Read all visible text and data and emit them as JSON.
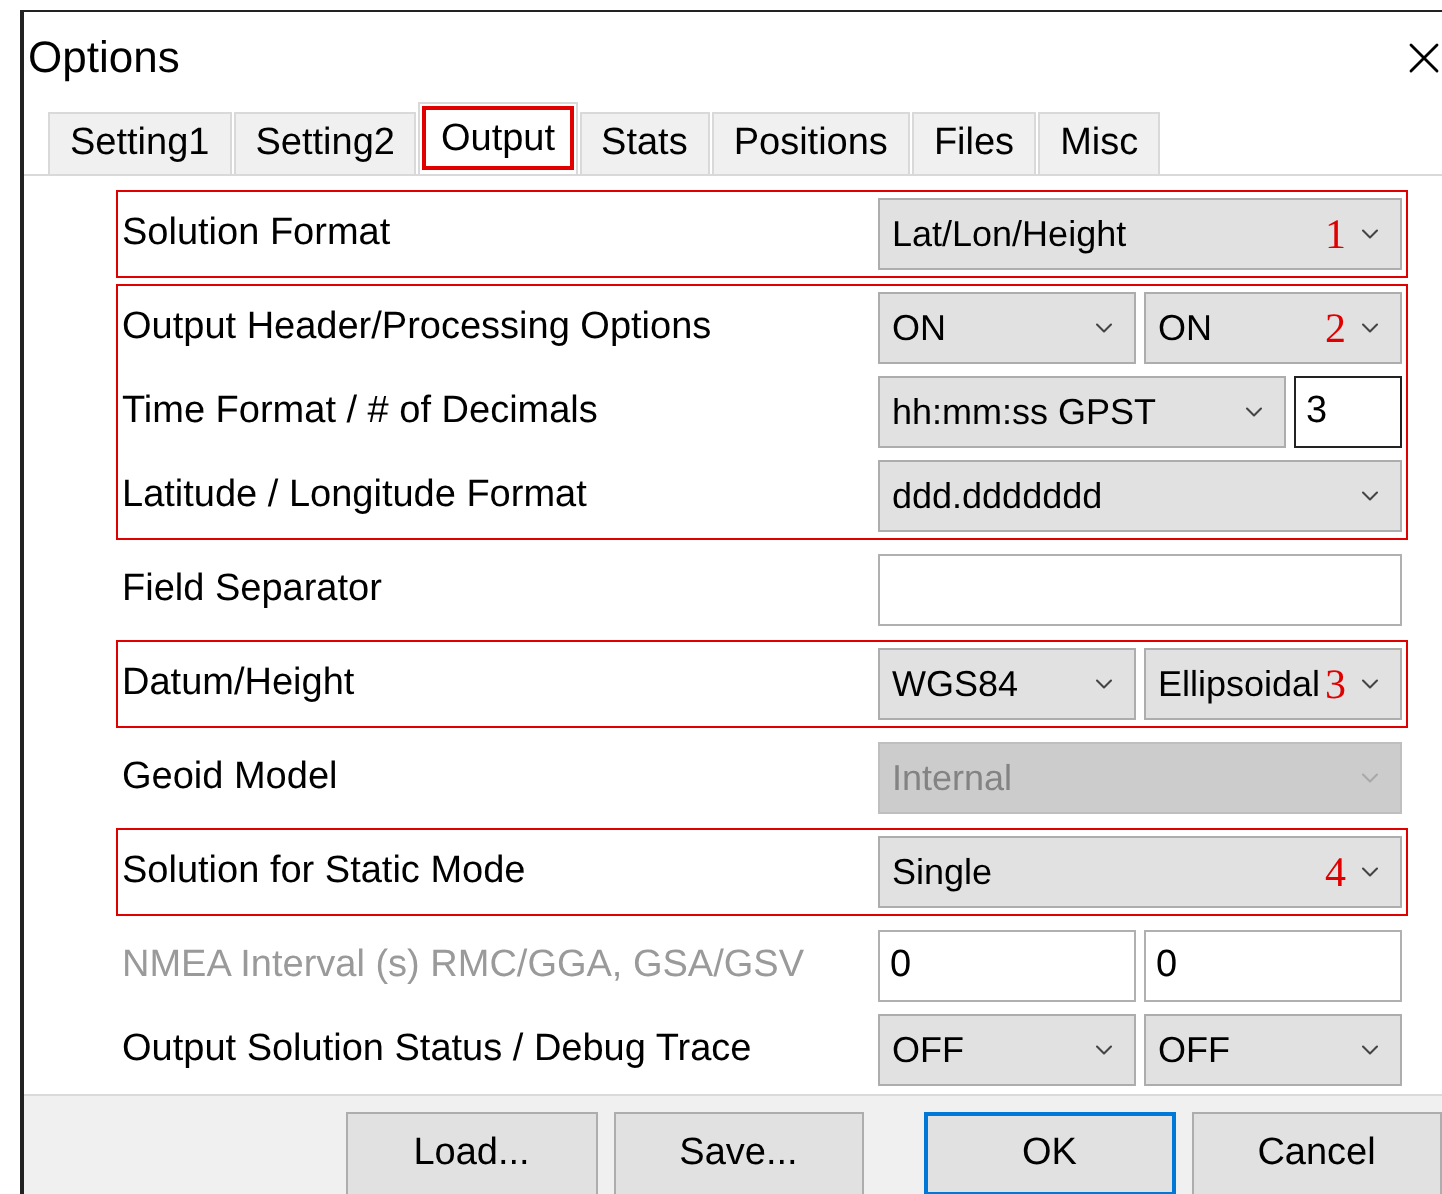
{
  "window": {
    "title": "Options"
  },
  "tabs": [
    {
      "label": "Setting1",
      "selected": false,
      "annotated": false
    },
    {
      "label": "Setting2",
      "selected": false,
      "annotated": false
    },
    {
      "label": "Output",
      "selected": true,
      "annotated": true
    },
    {
      "label": "Stats",
      "selected": false,
      "annotated": false
    },
    {
      "label": "Positions",
      "selected": false,
      "annotated": false
    },
    {
      "label": "Files",
      "selected": false,
      "annotated": false
    },
    {
      "label": "Misc",
      "selected": false,
      "annotated": false
    }
  ],
  "groups": [
    {
      "annotation": "1",
      "rows": [
        {
          "label": "Solution Format",
          "disabled": false,
          "controls": [
            {
              "kind": "combo",
              "value": "Lat/Lon/Height",
              "disabled": false
            }
          ]
        }
      ]
    },
    {
      "annotation": "2",
      "rows": [
        {
          "label": "Output Header/Processing Options",
          "disabled": false,
          "controls": [
            {
              "kind": "combo",
              "value": "ON",
              "disabled": false
            },
            {
              "kind": "combo",
              "value": "ON",
              "disabled": false
            }
          ]
        },
        {
          "label": "Time Format / # of Decimals",
          "disabled": false,
          "controls": [
            {
              "kind": "combo",
              "value": "hh:mm:ss GPST",
              "disabled": false
            },
            {
              "kind": "number",
              "value": "3"
            }
          ]
        },
        {
          "label": "Latitude / Longitude Format",
          "disabled": false,
          "controls": [
            {
              "kind": "combo",
              "value": "ddd.ddddddd",
              "disabled": false
            }
          ]
        }
      ]
    },
    {
      "rows": [
        {
          "label": "Field Separator",
          "disabled": false,
          "controls": [
            {
              "kind": "text"
            }
          ]
        }
      ]
    },
    {
      "annotation": "3",
      "rows": [
        {
          "label": "Datum/Height",
          "disabled": false,
          "controls": [
            {
              "kind": "combo",
              "value": "WGS84",
              "disabled": false
            },
            {
              "kind": "combo",
              "value": "Ellipsoidal",
              "disabled": false
            }
          ]
        }
      ]
    },
    {
      "rows": [
        {
          "label": "Geoid Model",
          "disabled": false,
          "controls": [
            {
              "kind": "combo",
              "value": "Internal",
              "disabled": true
            }
          ]
        }
      ]
    },
    {
      "annotation": "4",
      "rows": [
        {
          "label": "Solution for Static Mode",
          "disabled": false,
          "controls": [
            {
              "kind": "combo",
              "value": "Single",
              "disabled": false
            }
          ]
        }
      ]
    },
    {
      "rows": [
        {
          "label": "NMEA Interval (s) RMC/GGA, GSA/GSV",
          "disabled": true,
          "controls": [
            {
              "kind": "text",
              "value": "0"
            },
            {
              "kind": "text",
              "value": "0"
            }
          ]
        },
        {
          "label": "Output Solution Status / Debug Trace",
          "disabled": false,
          "controls": [
            {
              "kind": "combo",
              "value": "OFF",
              "disabled": false
            },
            {
              "kind": "combo",
              "value": "OFF",
              "disabled": false
            }
          ]
        }
      ]
    }
  ],
  "buttons": [
    {
      "label": "Load...",
      "default": false
    },
    {
      "label": "Save...",
      "default": false
    },
    {
      "label": "OK",
      "default": true
    },
    {
      "label": "Cancel",
      "default": false
    }
  ]
}
